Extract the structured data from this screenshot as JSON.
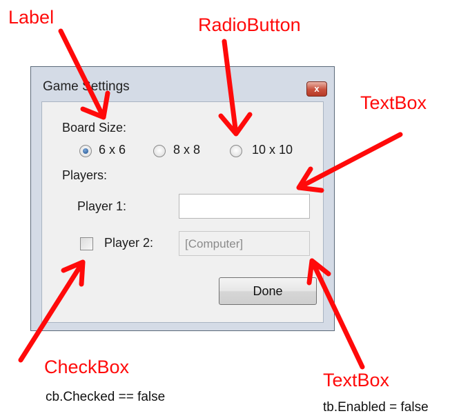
{
  "annotations": {
    "label": "Label",
    "radiobutton": "RadioButton",
    "textbox_top": "TextBox",
    "checkbox": "CheckBox",
    "checkbox_note": "cb.Checked == false",
    "textbox_bottom": "TextBox",
    "textbox_note": "tb.Enabled = false",
    "color": "#ff0a0a"
  },
  "window": {
    "title": "Game Settings",
    "close_glyph": "x"
  },
  "form": {
    "board_size_label": "Board Size:",
    "board_options": [
      {
        "label": "6 x 6",
        "checked": true
      },
      {
        "label": "8 x 8",
        "checked": false
      },
      {
        "label": "10 x 10",
        "checked": false
      }
    ],
    "players_label": "Players:",
    "player1_label": "Player 1:",
    "player1_value": "",
    "player2_label": "Player 2:",
    "player2_checked": false,
    "player2_value": "[Computer]",
    "player2_enabled": false,
    "done_label": "Done"
  }
}
